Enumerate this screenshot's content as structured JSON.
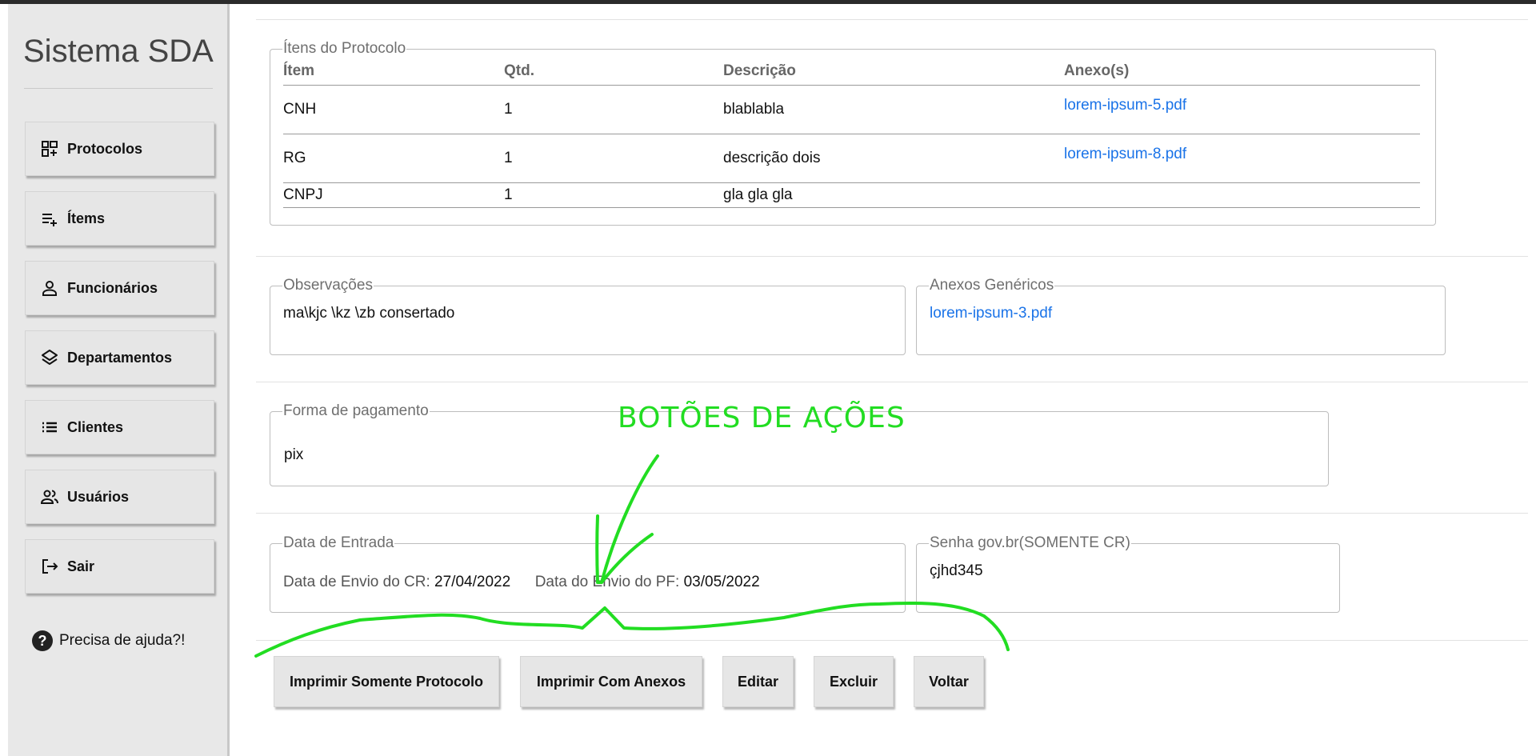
{
  "app": {
    "title": "Sistema SDA"
  },
  "sidebar": {
    "items": [
      {
        "label": "Protocolos",
        "icon": "dashboard-icon"
      },
      {
        "label": "Ítems",
        "icon": "playlist-add-icon"
      },
      {
        "label": "Funcionários",
        "icon": "person-icon"
      },
      {
        "label": "Departamentos",
        "icon": "layers-icon"
      },
      {
        "label": "Clientes",
        "icon": "list-icon"
      },
      {
        "label": "Usuários",
        "icon": "people-icon"
      },
      {
        "label": "Sair",
        "icon": "logout-icon"
      }
    ],
    "help": {
      "label": "Precisa de ajuda?!",
      "icon": "help-circle-icon"
    }
  },
  "items_section": {
    "legend": "Ítens do Protocolo",
    "columns": [
      "Ítem",
      "Qtd.",
      "Descrição",
      "Anexo(s)"
    ],
    "rows": [
      {
        "item": "CNH",
        "qtd": "1",
        "descricao": "blablabla",
        "anexo": "lorem-ipsum-5.pdf"
      },
      {
        "item": "RG",
        "qtd": "1",
        "descricao": "descrição dois",
        "anexo": "lorem-ipsum-8.pdf"
      },
      {
        "item": "CNPJ",
        "qtd": "1",
        "descricao": "gla gla gla",
        "anexo": ""
      }
    ]
  },
  "observacoes": {
    "legend": "Observações",
    "value": "ma\\kjc \\kz \\zb consertado"
  },
  "anexos_genericos": {
    "legend": "Anexos Genéricos",
    "file": "lorem-ipsum-3.pdf"
  },
  "pagamento": {
    "legend": "Forma de pagamento",
    "value": "pix"
  },
  "datas": {
    "legend": "Data de Entrada",
    "cr_label": "Data de Envio do CR:",
    "cr_value": "27/04/2022",
    "pf_label": "Data do Envio do PF:",
    "pf_value": "03/05/2022"
  },
  "senha": {
    "legend": "Senha gov.br(SOMENTE CR)",
    "value": "çjhd345"
  },
  "actions": {
    "print_protocol": "Imprimir Somente Protocolo",
    "print_with_attachments": "Imprimir Com Anexos",
    "edit": "Editar",
    "delete": "Excluir",
    "back": "Voltar"
  },
  "annotation": {
    "text": "BOTÕES DE AÇÕES",
    "color": "#22dd22"
  },
  "colors": {
    "link": "#1a73e8",
    "sidebar_bg": "#e8e8e8",
    "button_bg": "#e6e6e6"
  }
}
